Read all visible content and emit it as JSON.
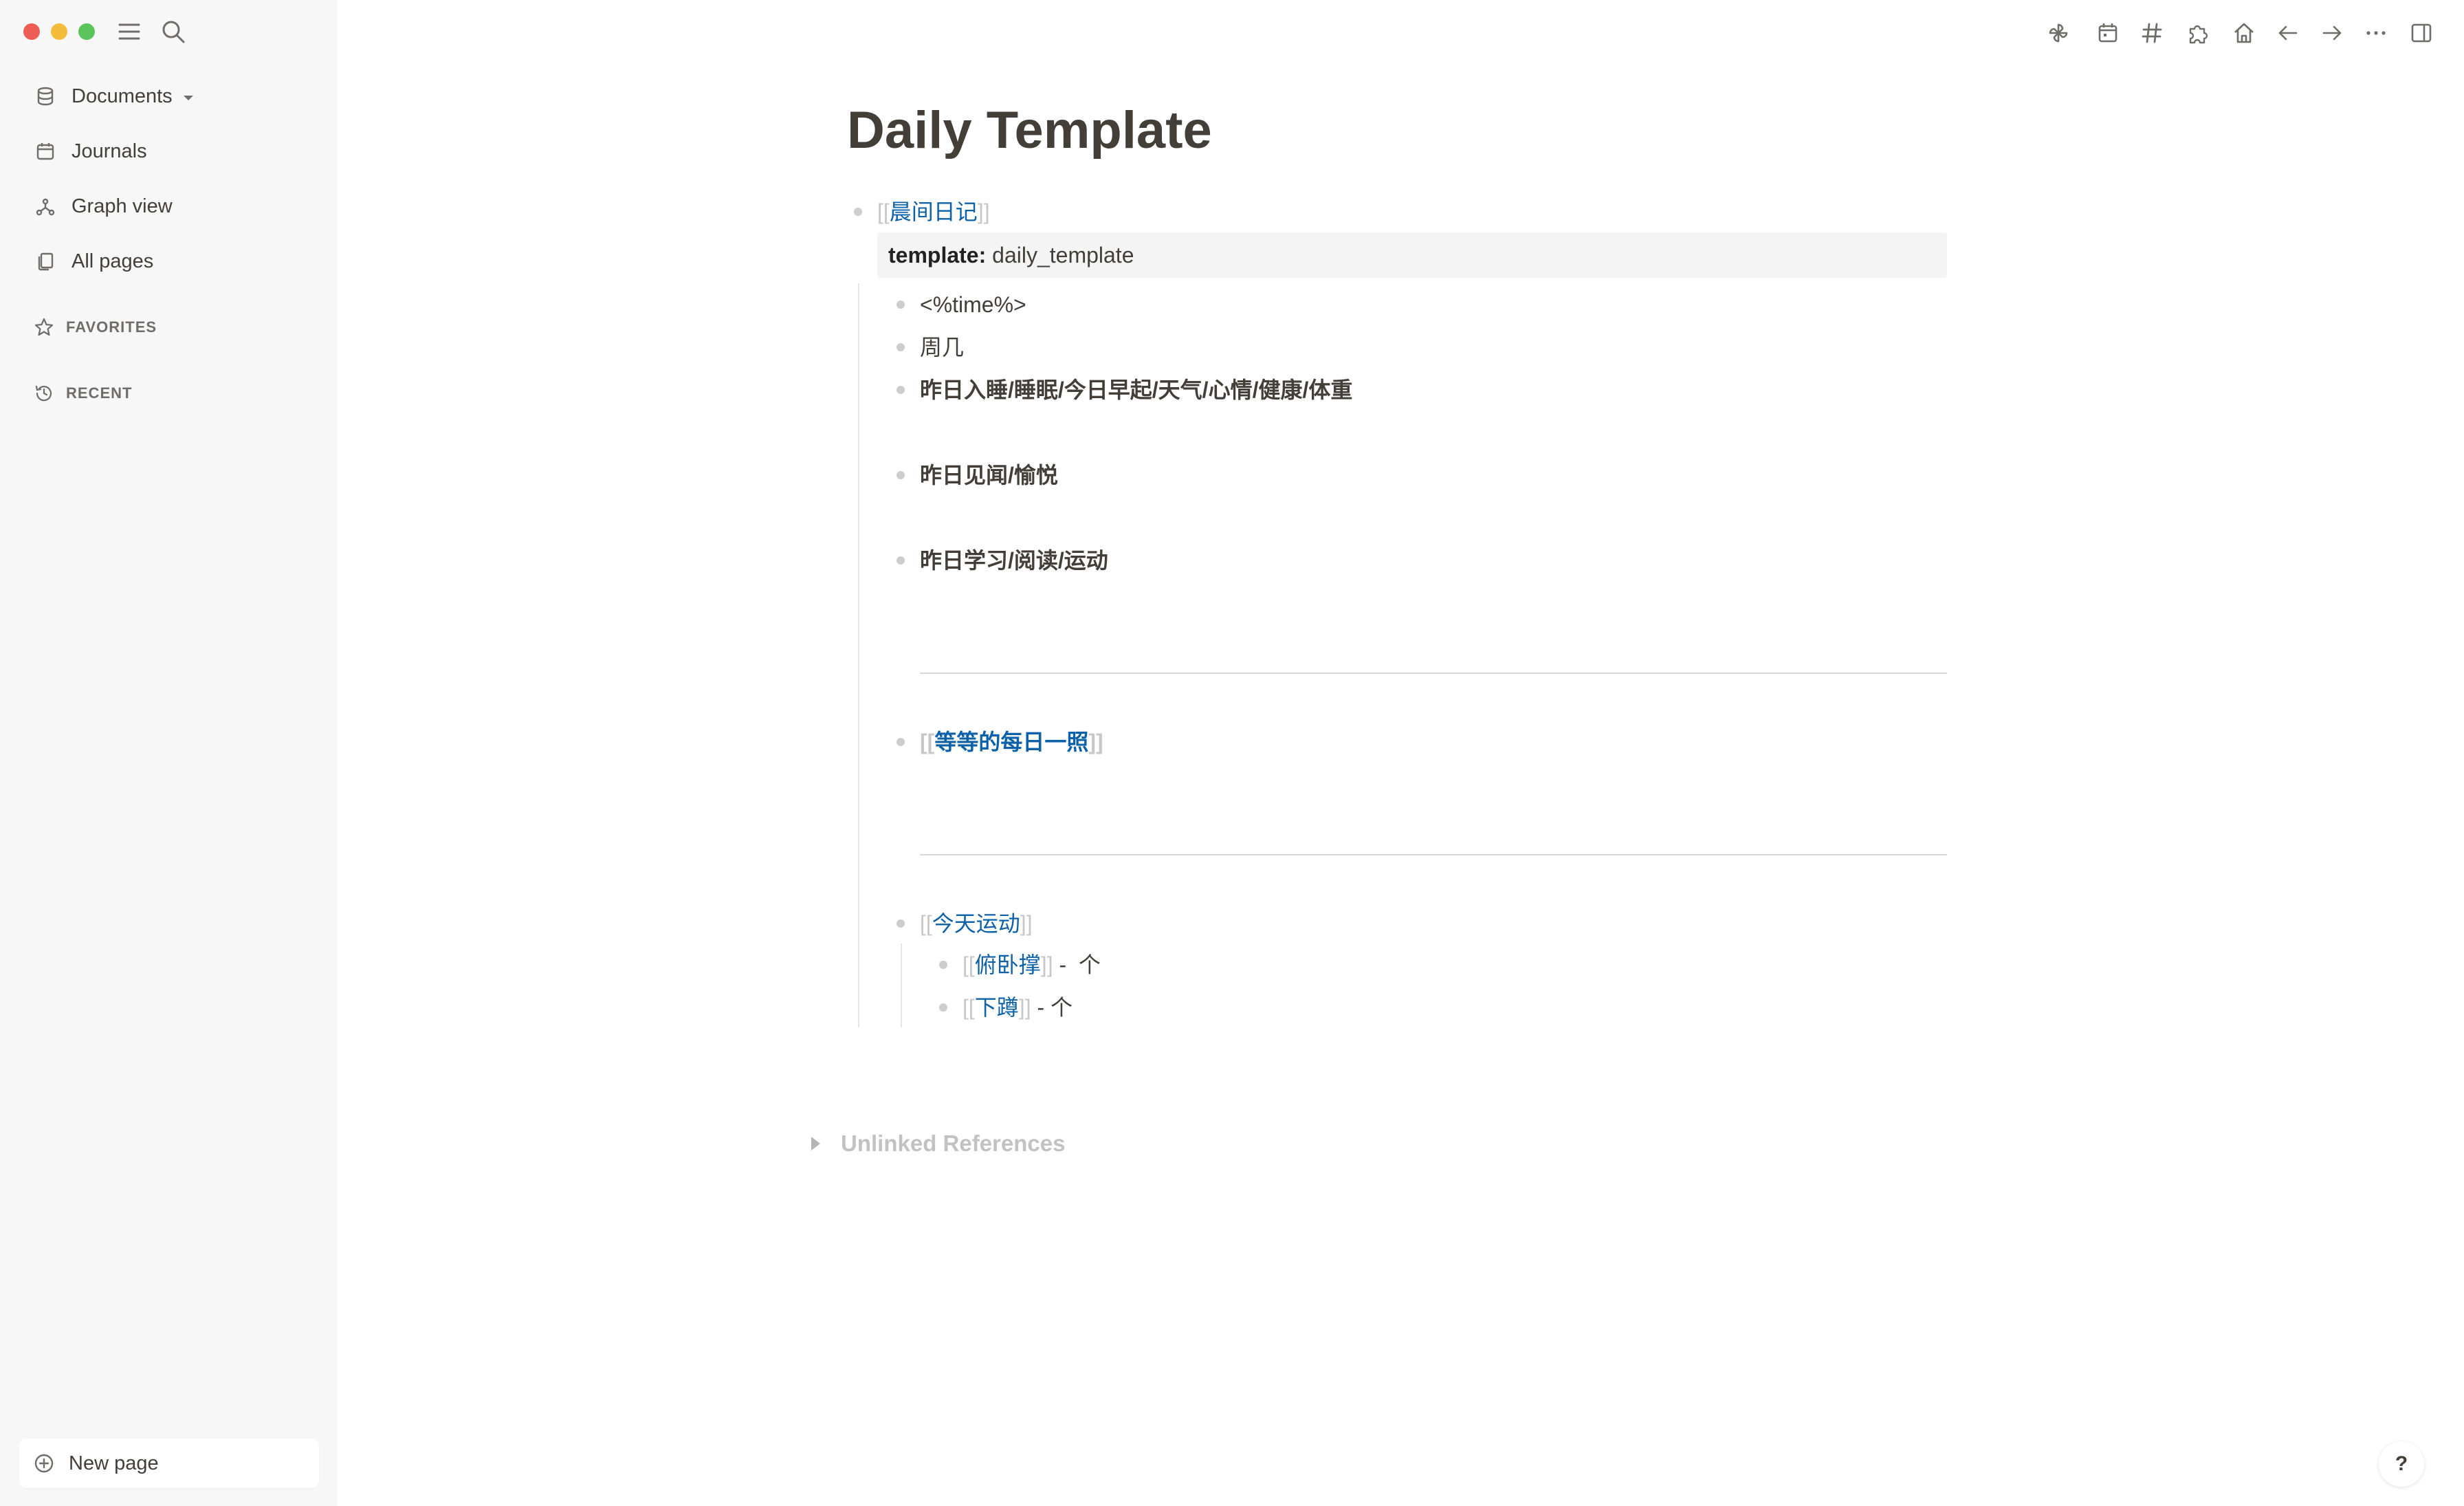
{
  "sidebar": {
    "nav": [
      {
        "label": "Documents",
        "icon": "database-icon"
      },
      {
        "label": "Journals",
        "icon": "calendar-icon"
      },
      {
        "label": "Graph view",
        "icon": "graph-icon"
      },
      {
        "label": "All pages",
        "icon": "pages-icon"
      }
    ],
    "favorites_label": "FAVORITES",
    "recent_label": "RECENT",
    "new_page_label": "New page"
  },
  "toolbar": {
    "icons": [
      "pinwheel-icon",
      "calendar-icon",
      "hash-icon",
      "puzzle-icon",
      "home-icon",
      "arrow-left-icon",
      "arrow-right-icon",
      "more-icon",
      "sidebar-toggle-icon"
    ]
  },
  "page": {
    "title": "Daily Template",
    "root_ref": "晨间日记",
    "property_key": "template",
    "property_sep": ":",
    "property_value": "daily_template",
    "items": {
      "time": "<%time%>",
      "weekday": "周几",
      "sleep": "昨日入睡/睡眠/今日早起/天气/心情/健康/体重",
      "seen": "昨日见闻/愉悦",
      "study": "昨日学习/阅读/运动",
      "photo_ref": "等等的每日一照",
      "exercise_ref": "今天运动",
      "pushup_ref": "俯卧撑",
      "pushup_suffix": " -  个",
      "squat_ref": "下蹲",
      "squat_suffix": " - 个"
    },
    "bracket_open": "[[",
    "bracket_close": "]]",
    "unlinked_label": "Unlinked References"
  },
  "help_label": "?",
  "colors": {
    "sidebar_bg": "#f7f7f7",
    "link": "#0d61a8",
    "text": "#433f38",
    "muted_bracket": "#c7c7c7"
  }
}
